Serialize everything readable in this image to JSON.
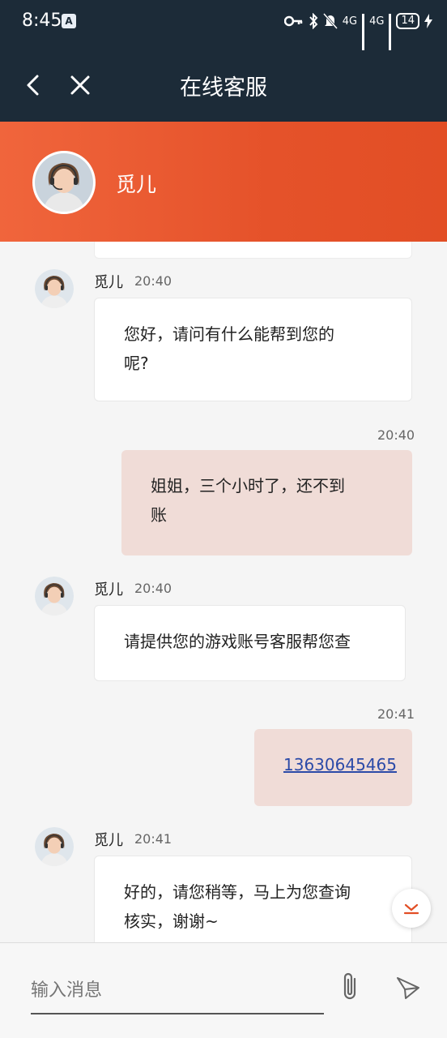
{
  "status_bar": {
    "time": "8:45",
    "app_badge": "A",
    "net1": "4G",
    "net2": "4G",
    "battery": "14"
  },
  "nav": {
    "title": "在线客服"
  },
  "agent": {
    "name": "觅儿"
  },
  "messages": [
    {
      "from": "agent",
      "sender": "觅儿",
      "time": "20:40",
      "line1": "您好，请问有什么能帮到您的",
      "line2": "呢?"
    },
    {
      "from": "user",
      "time": "20:40",
      "line1": "姐姐，三个小时了，还不到",
      "line2": "账"
    },
    {
      "from": "agent",
      "sender": "觅儿",
      "time": "20:40",
      "line1": "请提供您的游戏账号客服帮您查"
    },
    {
      "from": "user",
      "time": "20:41",
      "line1": "13630645465"
    },
    {
      "from": "agent",
      "sender": "觅儿",
      "time": "20:41",
      "line1": "好的，请您稍等，马上为您查询",
      "line2": "核实，谢谢~"
    }
  ],
  "input": {
    "placeholder": "输入消息"
  },
  "colors": {
    "topbar": "#1c2b38",
    "accent": "#e5522a",
    "user_bubble": "#f0dcd7"
  },
  "icons": [
    "back-icon",
    "close-icon",
    "paperclip-icon",
    "send-icon",
    "chevron-down-icon"
  ]
}
